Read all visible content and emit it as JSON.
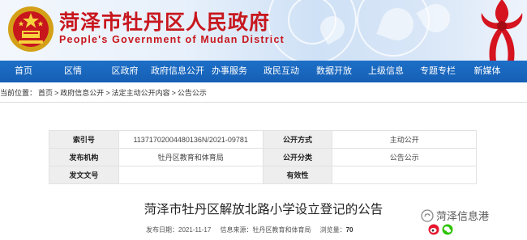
{
  "header": {
    "title": "菏泽市牡丹区人民政府",
    "subtitle": "People's Government of Mudan District",
    "emblem_icon": "national-emblem-icon",
    "knot_icon": "red-ribbon-knot-icon",
    "title_color": "#c8161d"
  },
  "nav": {
    "bg_color": "#1d6fc7",
    "items": [
      {
        "label": "首页"
      },
      {
        "label": "区情"
      },
      {
        "label": "区政府"
      },
      {
        "label": "政府信息公开"
      },
      {
        "label": "办事服务"
      },
      {
        "label": "政民互动"
      },
      {
        "label": "数据开放"
      },
      {
        "label": "上级信息"
      },
      {
        "label": "专题专栏"
      },
      {
        "label": "新媒体"
      }
    ]
  },
  "breadcrumb": {
    "prefix": "当前位置：",
    "items": [
      "首页",
      "政府信息公开",
      "法定主动公开内容",
      "公告公示"
    ],
    "separator": ">"
  },
  "info": {
    "index_key": "索引号",
    "index_value": "11371702004480136N/2021-09781",
    "form_key": "公开方式",
    "form_value": "主动公开",
    "org_key": "发布机构",
    "org_value": "牡丹区教育和体育局",
    "category_key": "公开分类",
    "category_value": "公告公示",
    "doc_key": "发文文号",
    "doc_value": "",
    "valid_key": "有效性",
    "valid_value": ""
  },
  "article": {
    "title": "菏泽市牡丹区解放北路小学设立登记的公告",
    "date_label": "发布日期：",
    "date": "2021-11-17",
    "source_label": "信息来源：",
    "source": "牡丹区教育和体育局",
    "views_label": "浏览量：",
    "views": "70"
  },
  "share": {
    "weibo_icon": "weibo-icon",
    "wechat_icon": "wechat-icon"
  },
  "watermark": {
    "text": "菏泽信息港",
    "icon": "wechat-official-account-icon"
  }
}
